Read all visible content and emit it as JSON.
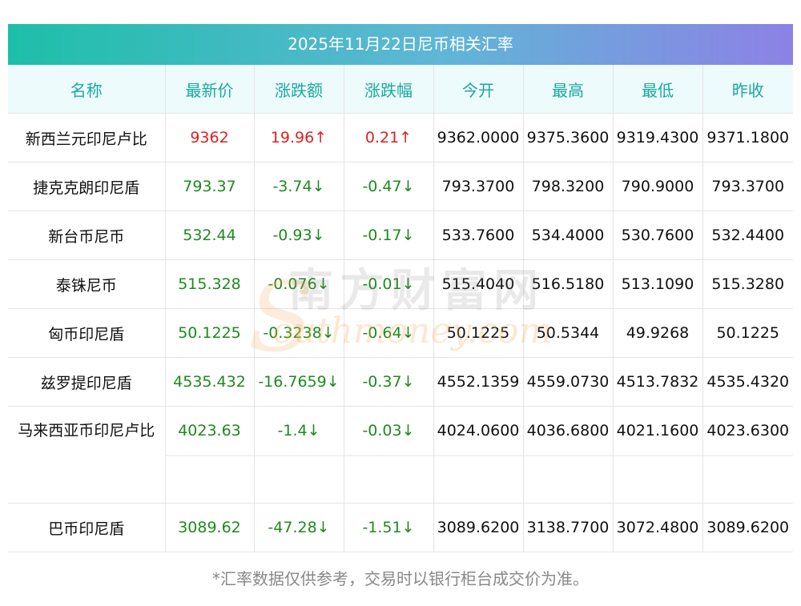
{
  "title": "2025年11月22日尼币相关汇率",
  "headers": [
    "名称",
    "最新价",
    "涨跌额",
    "涨跌幅",
    "今开",
    "最高",
    "最低",
    "昨收"
  ],
  "arrows": {
    "up": "↑",
    "down": "↓"
  },
  "rows": [
    {
      "name": "新西兰元印尼卢比",
      "latest": "9362",
      "change": "19.96",
      "pct": "0.21",
      "dir": "up",
      "open": "9362.0000",
      "high": "9375.3600",
      "low": "9319.4300",
      "prev": "9371.1800"
    },
    {
      "name": "捷克克朗印尼盾",
      "latest": "793.37",
      "change": "-3.74",
      "pct": "-0.47",
      "dir": "down",
      "open": "793.3700",
      "high": "798.3200",
      "low": "790.9000",
      "prev": "793.3700"
    },
    {
      "name": "新台币尼币",
      "latest": "532.44",
      "change": "-0.93",
      "pct": "-0.17",
      "dir": "down",
      "open": "533.7600",
      "high": "534.4000",
      "low": "530.7600",
      "prev": "532.4400"
    },
    {
      "name": "泰铢尼币",
      "latest": "515.328",
      "change": "-0.076",
      "pct": "-0.01",
      "dir": "down",
      "open": "515.4040",
      "high": "516.5180",
      "low": "513.1090",
      "prev": "515.3280"
    },
    {
      "name": "匈币印尼盾",
      "latest": "50.1225",
      "change": "-0.3238",
      "pct": "-0.64",
      "dir": "down",
      "open": "50.1225",
      "high": "50.5344",
      "low": "49.9268",
      "prev": "50.1225"
    },
    {
      "name": "兹罗提印尼盾",
      "latest": "4535.432",
      "change": "-16.7659",
      "pct": "-0.37",
      "dir": "down",
      "open": "4552.1359",
      "high": "4559.0730",
      "low": "4513.7832",
      "prev": "4535.4320"
    },
    {
      "name": "马来西亚币印尼卢比",
      "latest": "4023.63",
      "change": "-1.4",
      "pct": "-0.03",
      "dir": "down",
      "open": "4024.0600",
      "high": "4036.6800",
      "low": "4021.1600",
      "prev": "4023.6300"
    },
    {
      "name": "巴币印尼盾",
      "latest": "3089.62",
      "change": "-47.28",
      "pct": "-1.51",
      "dir": "down",
      "open": "3089.6200",
      "high": "3138.7700",
      "low": "3072.4800",
      "prev": "3089.6200"
    }
  ],
  "watermark": {
    "cn": "南方财富网",
    "en": "outhmoney.com",
    "s": "S"
  },
  "footnote": "*汇率数据仅供参考，交易时以银行柜台成交价为准。",
  "colors": {
    "up": "#e02020",
    "down": "#1e8a1e",
    "header_text": "#19a8a0"
  }
}
